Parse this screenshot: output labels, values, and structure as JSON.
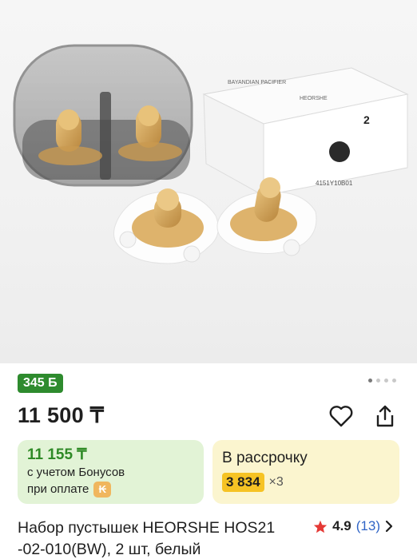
{
  "product": {
    "bonus_badge": "345 Б",
    "price": "11 500 ₸",
    "bonus_card": {
      "price": "11 155 ₸",
      "line1": "с учетом Бонусов",
      "line2": "при оплате"
    },
    "installment_card": {
      "title": "В рассрочку",
      "amount": "3 834",
      "multiplier": "×3"
    },
    "title": "Набор пустышек HEORSHE HOS21 -02-010(BW), 2 шт, белый",
    "rating": {
      "value": "4.9",
      "count": "(13)"
    },
    "carousel": {
      "total": 4,
      "active": 1
    }
  },
  "photo_text": {
    "brand": "HEORSHE",
    "box_label": "BAYANDIAN PACIFIER",
    "box_count": "2",
    "barcode": "4151Y10B01"
  },
  "colors": {
    "bonus_green": "#2e8b2e",
    "install_yellow": "#f6c324",
    "rating_star": "#e53935",
    "link_blue": "#2f64c6"
  },
  "icons": {
    "favorite": "heart-outline-icon",
    "share": "share-icon",
    "star": "star-icon",
    "chevron": "chevron-right-icon",
    "coin": "bonus-coin-icon"
  }
}
